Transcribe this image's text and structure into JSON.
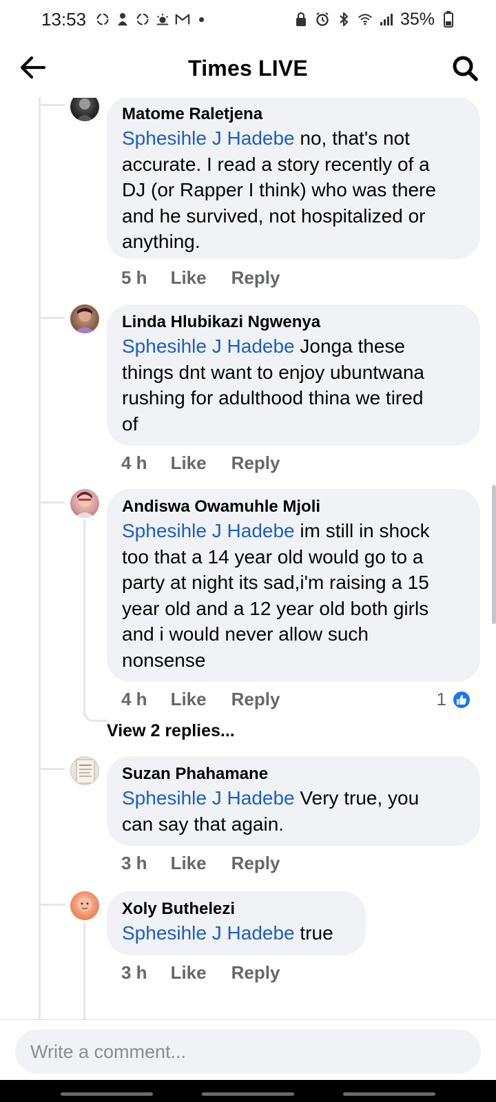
{
  "status_bar": {
    "time": "13:53",
    "battery": "35%",
    "left_icons": [
      "sync-icon",
      "person-icon",
      "sync-icon",
      "weather-icon",
      "gmail-icon"
    ],
    "right_icons": [
      "lock-icon",
      "alarm-icon",
      "bluetooth-icon",
      "wifi-icon",
      "signal-icon",
      "battery-icon"
    ]
  },
  "header": {
    "title": "Times LIVE",
    "back_icon": "arrow-left-icon",
    "search_icon": "search-icon"
  },
  "comments": [
    {
      "author": "Matome Raletjena",
      "mention": "Sphesihle J Hadebe",
      "lines": [
        "no, that's not",
        "accurate. I read a story recently of a",
        "DJ (or Rapper I think) who was there",
        "and he survived, not hospitalized or",
        "anything."
      ],
      "time": "5 h",
      "like": "Like",
      "reply": "Reply"
    },
    {
      "author": "Linda Hlubikazi Ngwenya",
      "mention": "Sphesihle J Hadebe",
      "lines": [
        "Jonga these",
        "things dnt want to enjoy ubuntwana",
        "rushing for adulthood thina we tired",
        "of"
      ],
      "time": "4 h",
      "like": "Like",
      "reply": "Reply"
    },
    {
      "author": "Andiswa Owamuhle Mjoli",
      "mention": "Sphesihle J Hadebe",
      "lines": [
        "im still in shock",
        "too that a 14 year old would go to a",
        "party at night its sad,i'm raising a 15",
        "year old and a 12 year old  both girls",
        "and i would never allow such",
        "nonsense"
      ],
      "time": "4 h",
      "like": "Like",
      "reply": "Reply",
      "reaction_count": "1",
      "view_replies": "View 2 replies..."
    },
    {
      "author": "Suzan Phahamane",
      "mention": "Sphesihle J Hadebe",
      "lines": [
        "Very true, you",
        "can say that again."
      ],
      "time": "3 h",
      "like": "Like",
      "reply": "Reply"
    },
    {
      "author": "Xoly Buthelezi",
      "mention": "Sphesihle J Hadebe",
      "lines": [
        "true"
      ],
      "time": "3 h",
      "like": "Like",
      "reply": "Reply"
    }
  ],
  "composer": {
    "placeholder": "Write a comment..."
  },
  "colors": {
    "mention": "#1b5ec8",
    "bubble": "#f0f2f5",
    "meta": "#65676b",
    "like_badge": "#1877f2"
  }
}
